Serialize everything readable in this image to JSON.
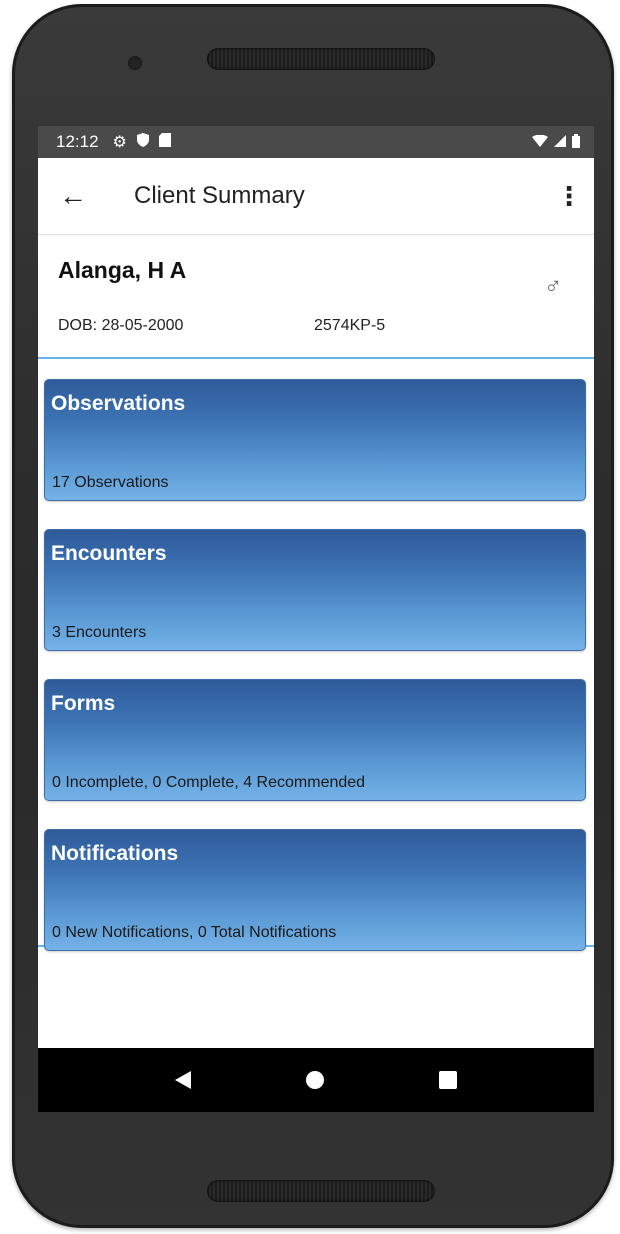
{
  "status_bar": {
    "time": "12:12",
    "icons": [
      "gear-icon",
      "shield-icon",
      "sd-card-icon"
    ],
    "right_icons": [
      "wifi-icon",
      "signal-icon",
      "battery-icon"
    ]
  },
  "app_bar": {
    "title": "Client Summary",
    "back_icon": "arrow-left-icon",
    "menu_icon": "more-vert-icon"
  },
  "client": {
    "name": "Alanga, H A",
    "dob": "DOB: 28-05-2000",
    "id": "2574KP-5",
    "gender_icon": "male-icon"
  },
  "cards": [
    {
      "title": "Observations",
      "subtitle": "17 Observations"
    },
    {
      "title": "Encounters",
      "subtitle": "3 Encounters"
    },
    {
      "title": "Forms",
      "subtitle": "0 Incomplete, 0 Complete, 4 Recommended"
    },
    {
      "title": "Notifications",
      "subtitle": "0 New Notifications, 0 Total Notifications"
    }
  ],
  "colors": {
    "card_top": "#2f5a99",
    "card_bottom": "#74b2e8",
    "divider": "#64b5e6",
    "status_bar": "#4a4a4a"
  }
}
